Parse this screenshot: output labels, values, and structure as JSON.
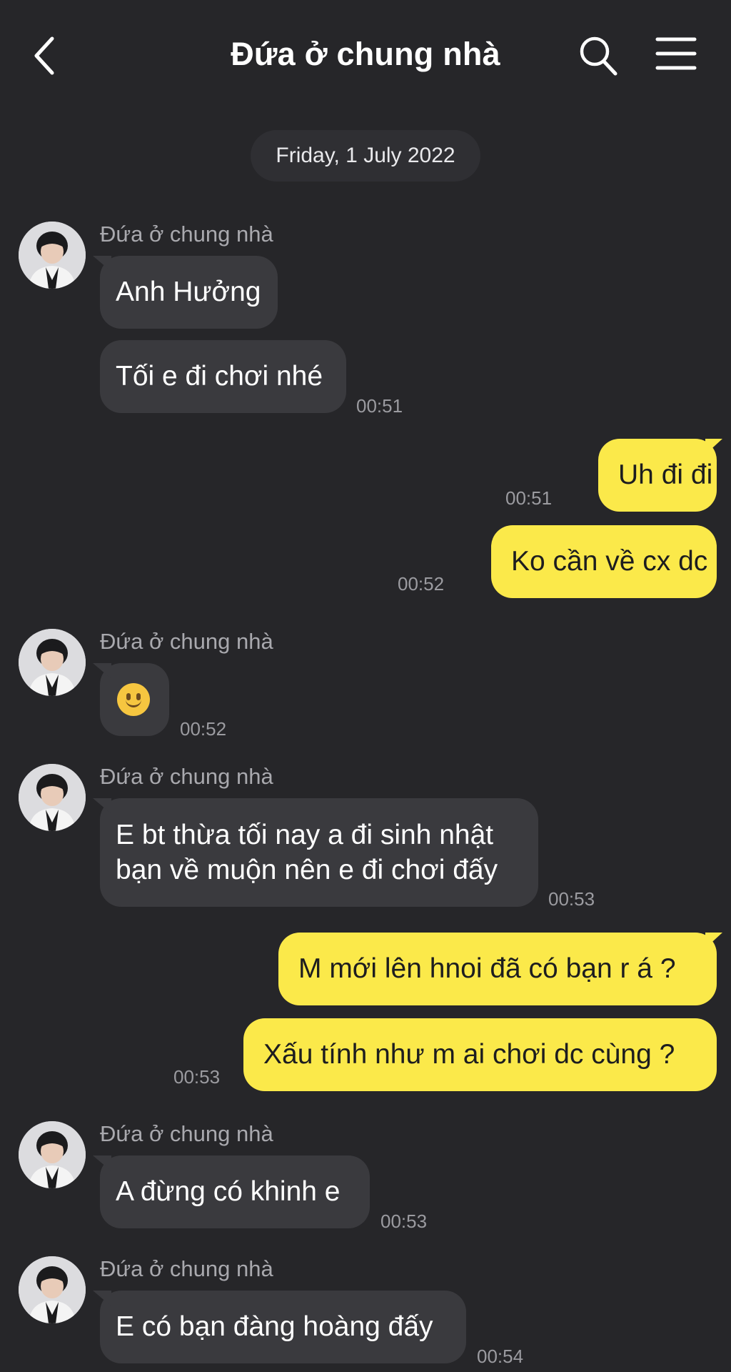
{
  "header": {
    "title": "Đứa ở chung nhà",
    "back_icon": "chevron-left-icon",
    "search_icon": "search-icon",
    "menu_icon": "hamburger-menu-icon"
  },
  "date_separator": "Friday, 1 July 2022",
  "colors": {
    "background": "#262629",
    "incoming_bubble": "#3a3a3e",
    "outgoing_bubble": "#fbe94a",
    "timestamp": "#9b9ba0"
  },
  "messages": [
    {
      "sender": "Đứa ở chung nhà",
      "texts": [
        "Anh Hưởng",
        "Tối e đi chơi nhé"
      ],
      "time": "00:51"
    },
    {
      "outgoing": true,
      "text": "Uh đi đi",
      "time": "00:51"
    },
    {
      "outgoing": true,
      "text": "Ko cần về cx dc",
      "time": "00:52"
    },
    {
      "sender": "Đứa ở chung nhà",
      "emoji": "slightly-smiling-face-emoji",
      "time": "00:52"
    },
    {
      "sender": "Đứa ở chung nhà",
      "lines": [
        "E bt thừa tối nay a đi sinh nhật",
        "bạn về muộn nên e đi chơi đấy"
      ],
      "time": "00:53"
    },
    {
      "outgoing": true,
      "text": "M mới lên hnoi đã có bạn r á ?"
    },
    {
      "outgoing": true,
      "text": "Xấu tính như m ai chơi dc cùng ?",
      "time": "00:53"
    },
    {
      "sender": "Đứa ở chung nhà",
      "text": "A đừng có khinh e",
      "time": "00:53"
    },
    {
      "sender": "Đứa ở chung nhà",
      "text": "E có bạn đàng hoàng đấy",
      "time": "00:54"
    }
  ]
}
